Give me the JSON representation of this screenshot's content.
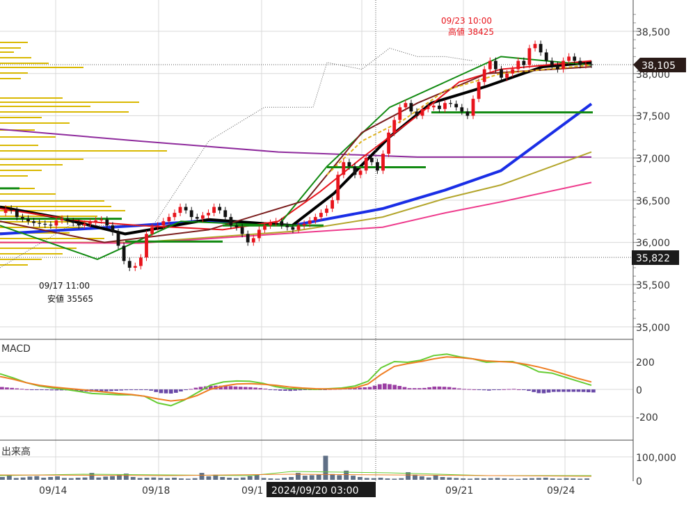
{
  "price_panel": {
    "high_annotation": {
      "time": "09/23 10:00",
      "label": "高値 38425"
    },
    "low_annotation": {
      "time": "09/17 11:00",
      "label": "安値 35565"
    },
    "current_price_label": "38,105",
    "low_price_label": "35,822",
    "y_ticks": [
      "38,500",
      "38,000",
      "37,500",
      "37,000",
      "36,500",
      "36,000",
      "35,500",
      "35,000"
    ]
  },
  "macd_panel": {
    "title": "MACD",
    "y_ticks": [
      "200",
      "0",
      "-200"
    ]
  },
  "volume_panel": {
    "title": "出来高",
    "y_ticks": [
      "100,000",
      "0"
    ]
  },
  "x_axis": {
    "labels": [
      "09/14",
      "09/18",
      "09/1",
      "09/21",
      "09/24"
    ],
    "crosshair_label": "2024/09/20 03:00"
  },
  "colors": {
    "up": "#e8141c",
    "down": "#111111",
    "ma_black": "#000000",
    "ma_blue": "#1a2ee6",
    "ma_olive": "#b3a52b",
    "ma_pink": "#ee3a8c",
    "ma_purple": "#8e2a9c",
    "macd": "#66cc33",
    "signal": "#ef7d22",
    "hist_pos": "#9b3fa3",
    "hist_neg": "#6a4aa8",
    "volume": "#5f6f86",
    "volume_profile": "#d9b800",
    "level_green": "#118a11",
    "label_dark": "#2a1b18",
    "label_dark2": "#1b1b1b"
  },
  "chart_data": [
    {
      "type": "candlestick",
      "title": "",
      "x": [
        "09/14",
        "09/18",
        "09/20",
        "09/21",
        "09/24"
      ],
      "ylim": [
        34900,
        38850
      ],
      "y_ticks": [
        35000,
        35500,
        36000,
        36500,
        37000,
        37500,
        38000,
        38500
      ],
      "grid": true,
      "high": {
        "time": "09/23 10:00",
        "value": 38425
      },
      "low": {
        "time": "09/17 11:00",
        "value": 35565
      },
      "current": 38105,
      "reference_line": 35822,
      "close_series": [
        36350,
        36400,
        36380,
        36300,
        36280,
        36250,
        36230,
        36220,
        36210,
        36200,
        36260,
        36280,
        36250,
        36230,
        36200,
        36220,
        36240,
        36260,
        36270,
        36200,
        36120,
        35960,
        35780,
        35700,
        35720,
        35820,
        36100,
        36180,
        36200,
        36250,
        36300,
        36350,
        36420,
        36380,
        36300,
        36280,
        36320,
        36350,
        36420,
        36380,
        36300,
        36200,
        36180,
        36100,
        36000,
        36050,
        36150,
        36200,
        36230,
        36250,
        36200,
        36180,
        36150,
        36200,
        36220,
        36260,
        36300,
        36350,
        36400,
        36500,
        36800,
        36950,
        36900,
        36800,
        36850,
        37000,
        36950,
        36850,
        37050,
        37300,
        37450,
        37600,
        37650,
        37550,
        37500,
        37580,
        37600,
        37620,
        37580,
        37650,
        37640,
        37600,
        37550,
        37500,
        37700,
        37900,
        38050,
        38150,
        38050,
        37950,
        38000,
        38050,
        38150,
        38100,
        38300,
        38350,
        38250,
        38150,
        38100,
        38050,
        38150,
        38200,
        38150,
        38100,
        38110,
        38105
      ]
    },
    {
      "type": "line",
      "title": "MACD",
      "ylim": [
        -300,
        300
      ],
      "y_ticks": [
        200,
        0,
        -200
      ],
      "series": [
        {
          "values": [
            115,
            85,
            50,
            25,
            10,
            0,
            -15,
            -30,
            -35,
            -40,
            -40,
            -50,
            -100,
            -120,
            -80,
            -25,
            30,
            55,
            62,
            60,
            45,
            20,
            5,
            5,
            0,
            5,
            10,
            25,
            60,
            160,
            205,
            200,
            215,
            250,
            260,
            240,
            225,
            200,
            205,
            205,
            175,
            130,
            120,
            90,
            60,
            30
          ]
        },
        {
          "values": [
            95,
            75,
            50,
            30,
            18,
            8,
            0,
            -10,
            -20,
            -30,
            -38,
            -50,
            -70,
            -85,
            -75,
            -45,
            0,
            25,
            40,
            42,
            38,
            30,
            18,
            10,
            5,
            3,
            5,
            12,
            40,
            110,
            170,
            190,
            205,
            225,
            240,
            235,
            225,
            210,
            205,
            200,
            185,
            165,
            140,
            110,
            80,
            55
          ]
        }
      ]
    },
    {
      "type": "bar",
      "title": "出来高",
      "ylim": [
        0,
        120000
      ],
      "y_ticks": [
        0,
        100000
      ],
      "values": [
        12000,
        18000,
        8000,
        10000,
        14000,
        16000,
        9000,
        12000,
        15000,
        8000,
        7000,
        9000,
        10000,
        30000,
        10000,
        14000,
        16000,
        22000,
        27000,
        12000,
        8000,
        9000,
        10000,
        8000,
        7000,
        9000,
        6000,
        5000,
        7000,
        30000,
        15000,
        22000,
        12000,
        9000,
        7000,
        10000,
        16000,
        22000,
        8000,
        6000,
        5000,
        9000,
        12000,
        30000,
        18000,
        20000,
        22000,
        105000,
        25000,
        20000,
        40000,
        18000,
        12000,
        8000,
        7000,
        9000,
        6000,
        5000,
        7000,
        33000,
        22000,
        15000,
        10000,
        20000,
        12000,
        10000,
        8000,
        6000,
        5000,
        7000,
        6000,
        7000,
        8000,
        6000,
        5000,
        4000,
        6000,
        7000,
        8000,
        9000,
        6000,
        5000,
        7000,
        6000,
        5000,
        6000
      ]
    }
  ]
}
